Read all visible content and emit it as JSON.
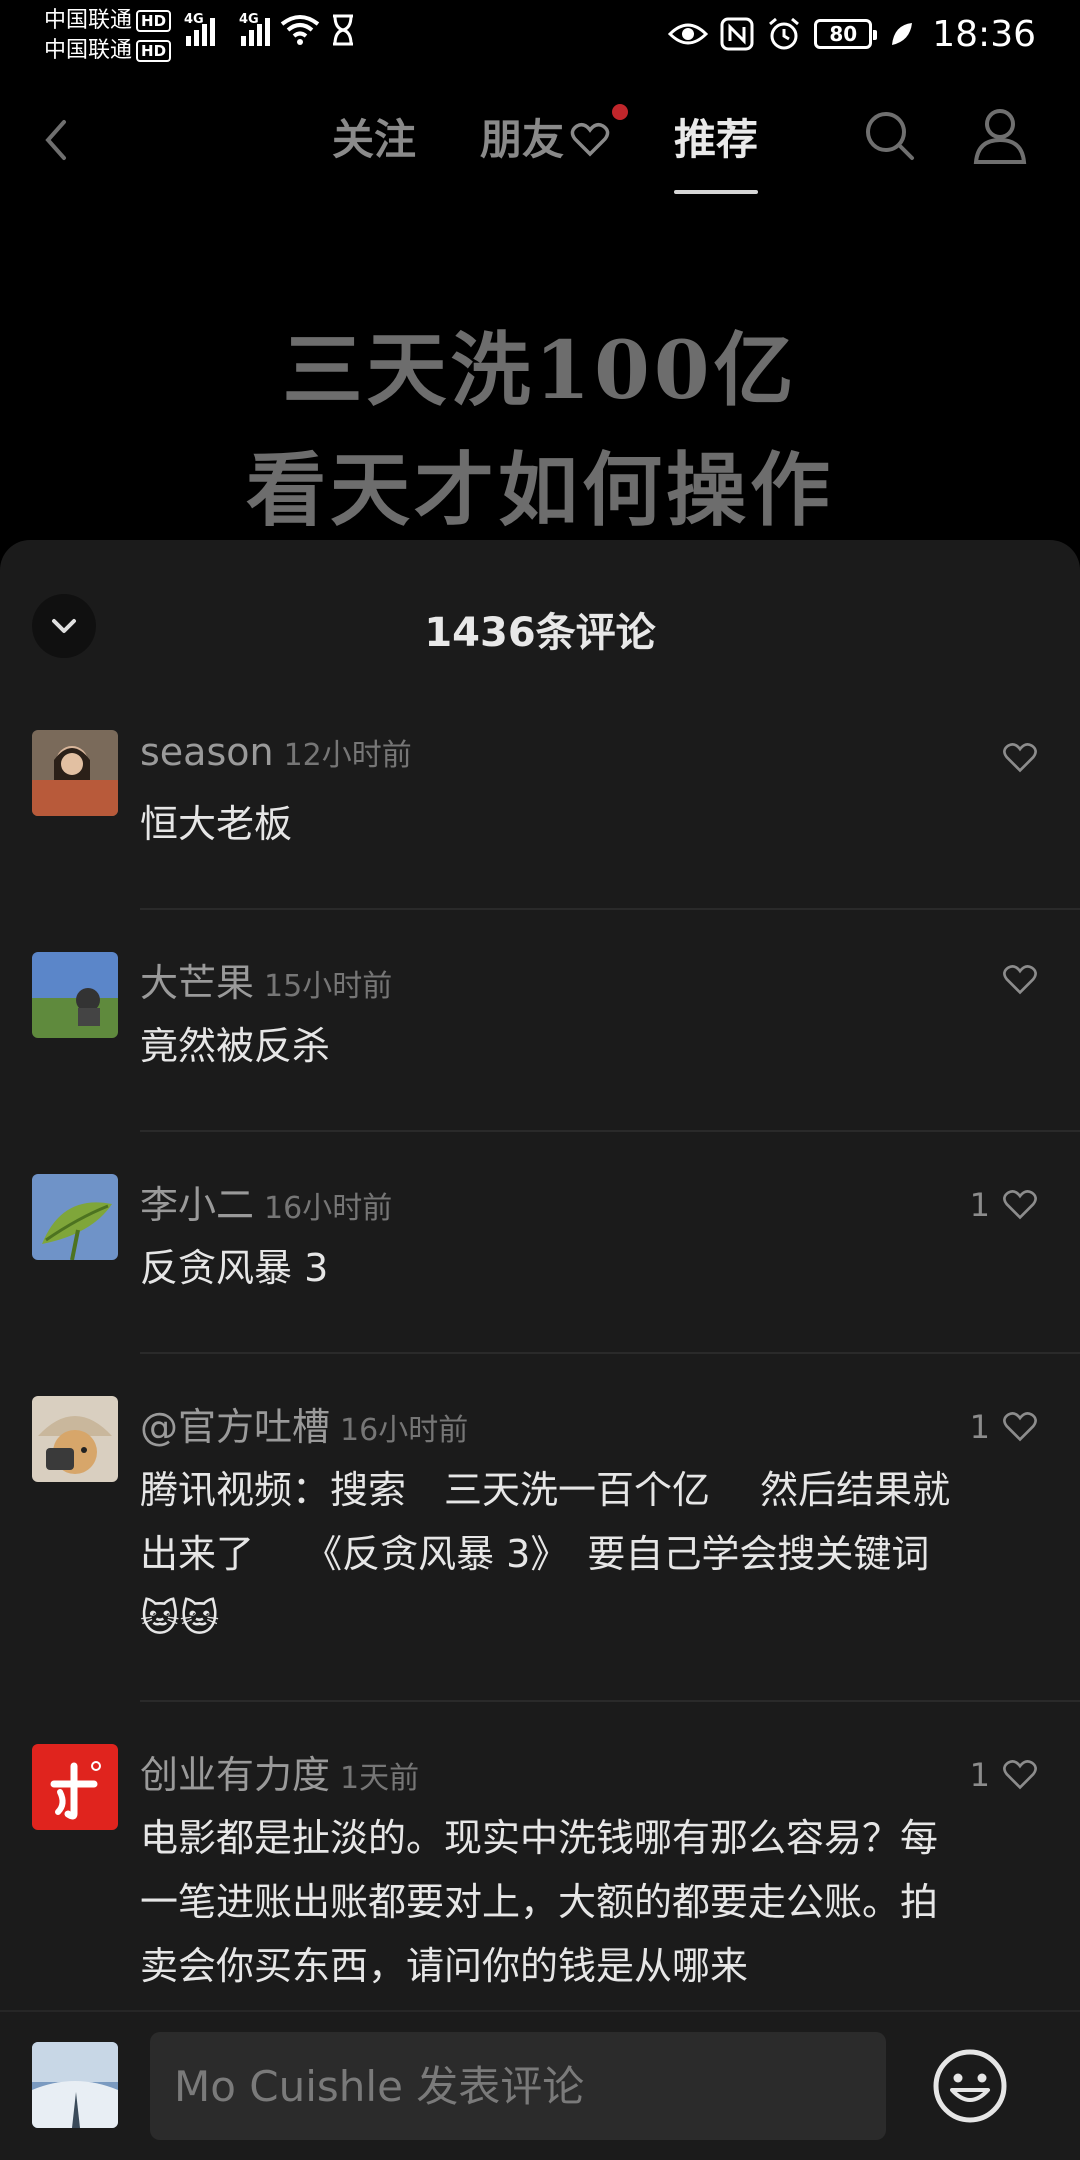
{
  "status_bar": {
    "carrier1": "中国联通",
    "carrier2": "中国联通",
    "hd_label": "HD",
    "network1": "4G",
    "network2": "4G",
    "battery_level": "80",
    "time": "18:36",
    "icons": [
      "wifi-icon",
      "hourglass-icon",
      "eye-icon",
      "nfc-icon",
      "alarm-icon",
      "battery-icon",
      "leaf-icon"
    ]
  },
  "nav": {
    "tabs": [
      {
        "label": "关注",
        "active": false
      },
      {
        "label": "朋友",
        "active": false,
        "has_badge": true
      },
      {
        "label": "推荐",
        "active": true
      }
    ],
    "icons": [
      "back-icon",
      "heart-icon",
      "search-icon",
      "profile-icon"
    ]
  },
  "video": {
    "title_line1": "三天洗100亿",
    "title_line2": "看天才如何操作"
  },
  "comments_panel": {
    "count_label": "1436条评论",
    "comments": [
      {
        "name": "season",
        "time": "12小时前",
        "text": "恒大老板",
        "likes": ""
      },
      {
        "name": "大芒果",
        "time": "15小时前",
        "text": "竟然被反杀",
        "likes": ""
      },
      {
        "name": "李小二",
        "time": "16小时前",
        "text": "反贪风暴 3",
        "likes": "1"
      },
      {
        "name": "@官方吐槽",
        "time": "16小时前",
        "text": "腾讯视频：搜索　三天洗一百个亿　 然后结果就出来了　 《反贪风暴 3》　要自己学会搜关键词🐱🐱",
        "likes": "1"
      },
      {
        "name": "创业有力度",
        "time": "1天前",
        "text": "电影都是扯淡的。现实中洗钱哪有那么容易？每一笔进账出账都要对上，大额的都要走公账。拍卖会你买东西，请问你的钱是从哪来",
        "likes": "1"
      }
    ]
  },
  "input_bar": {
    "placeholder": "Mo Cuishle 发表评论",
    "icons": [
      "emoji-icon"
    ]
  },
  "colors": {
    "background": "#000000",
    "sheet": "#1b1b1b",
    "badge_red": "#c0262b"
  }
}
